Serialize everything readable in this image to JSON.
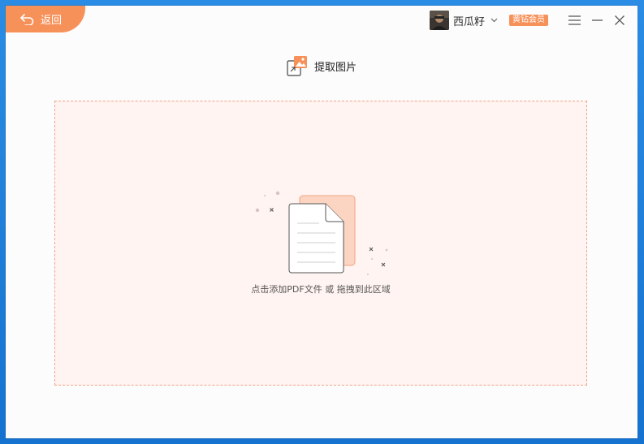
{
  "header": {
    "back_label": "返回",
    "username": "西瓜籽",
    "vip_badge": "黄钻会员"
  },
  "main": {
    "title": "提取图片",
    "drop_hint": "点击添加PDF文件 或 拖拽到此区域"
  },
  "colors": {
    "accent": "#f7915a",
    "drop_zone_bg": "#fff4f1",
    "drop_zone_border": "#f0a585"
  }
}
